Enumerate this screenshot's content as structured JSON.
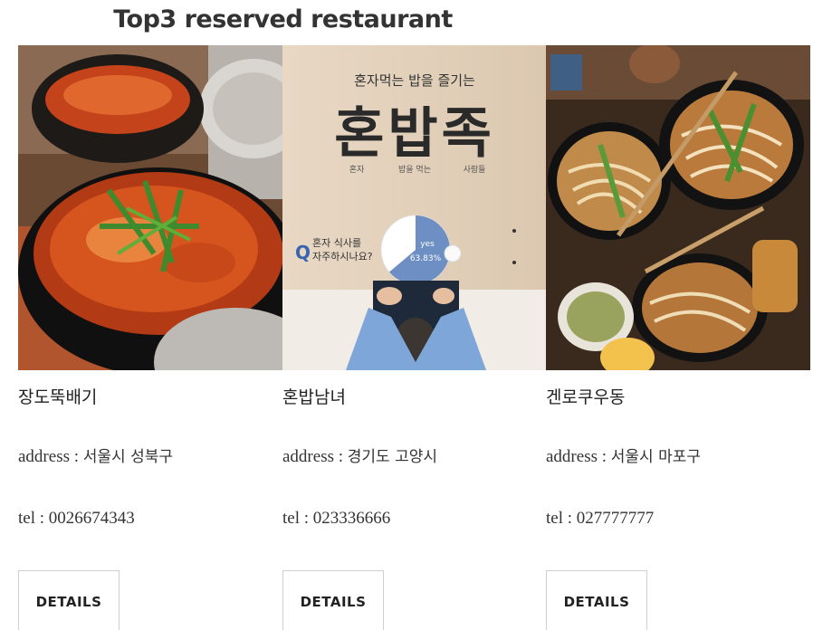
{
  "page": {
    "title": "Top3 reserved restaurant"
  },
  "restaurants": [
    {
      "name": "장도뚝배기",
      "address_label": "address : ",
      "address": "서울시 성북구",
      "tel_label": "tel : ",
      "tel": "0026674343",
      "details_label": "DETAILS",
      "photo": "stew-dish-photo"
    },
    {
      "name": "혼밥남녀",
      "address_label": "address : ",
      "address": "경기도 고양시",
      "tel_label": "tel : ",
      "tel": "023336666",
      "details_label": "DETAILS",
      "photo": "honbap-poster-photo",
      "poster": {
        "headline_small": "혼자먹는 밥을 즐기는",
        "headline_big": "혼밥족",
        "sub1": "혼자",
        "sub2": "밥을 먹는",
        "sub3": "사람들",
        "question_mark": "Q",
        "question": "혼자 식사를 자주하시나요?",
        "question_line1": "혼자 식사를",
        "question_line2": "자주하시나요?",
        "pie_label": "yes",
        "pie_value": "63.83%",
        "pie_fraction": 0.6383
      }
    },
    {
      "name": "겐로쿠우동",
      "address_label": "address : ",
      "address": "서울시 마포구",
      "tel_label": "tel : ",
      "tel": "027777777",
      "details_label": "DETAILS",
      "photo": "udon-noodle-photo"
    }
  ],
  "colors": {
    "button_border": "#cfcfcf",
    "title_text": "#333333",
    "pie_blue": "#6d8fc4"
  }
}
